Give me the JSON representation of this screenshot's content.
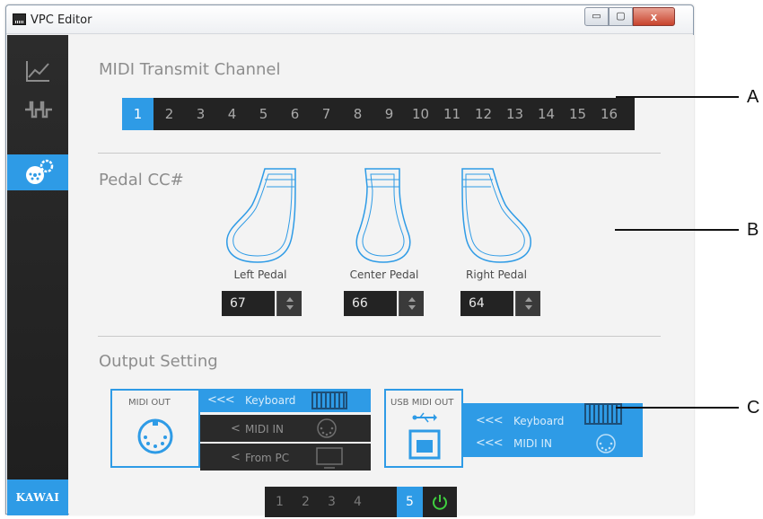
{
  "window": {
    "title": "VPC Editor",
    "controls": {
      "minimize": "▭",
      "maximize": "▢",
      "close": "x"
    }
  },
  "sidebar": {
    "items": [
      {
        "icon": "graph-icon"
      },
      {
        "icon": "waveform-icon"
      },
      {
        "icon": "midi-settings-icon",
        "active": true
      }
    ],
    "logo": "KAWAI"
  },
  "midi_transmit": {
    "title": "MIDI Transmit Channel",
    "channels": [
      "1",
      "2",
      "3",
      "4",
      "5",
      "6",
      "7",
      "8",
      "9",
      "10",
      "11",
      "12",
      "13",
      "14",
      "15",
      "16"
    ],
    "selected": "1"
  },
  "pedal_cc": {
    "title": "Pedal CC#",
    "pedals": [
      {
        "label": "Left Pedal",
        "value": "67"
      },
      {
        "label": "Center Pedal",
        "value": "66"
      },
      {
        "label": "Right Pedal",
        "value": "64"
      }
    ]
  },
  "output_setting": {
    "title": "Output Setting",
    "midi_out": {
      "label": "MIDI OUT",
      "sources": [
        {
          "arrow": "<<<",
          "label": "Keyboard",
          "active": true
        },
        {
          "arrow": "<",
          "label": "MIDI IN",
          "active": false
        },
        {
          "arrow": "<",
          "label": "From PC",
          "active": false
        }
      ]
    },
    "usb_midi_out": {
      "label": "USB MIDI OUT",
      "sources": [
        {
          "arrow": "<<<",
          "label": "Keyboard",
          "active": true
        },
        {
          "arrow": "<<<",
          "label": "MIDI IN",
          "active": true
        }
      ]
    }
  },
  "bottom_nav": {
    "items": [
      "1",
      "2",
      "3",
      "4",
      "5"
    ],
    "selected": "5",
    "power_icon": "power-icon"
  },
  "callouts": [
    "A",
    "B",
    "C"
  ],
  "colors": {
    "accent": "#2e9be6",
    "dark": "#232323",
    "sidebar": "#262626"
  }
}
